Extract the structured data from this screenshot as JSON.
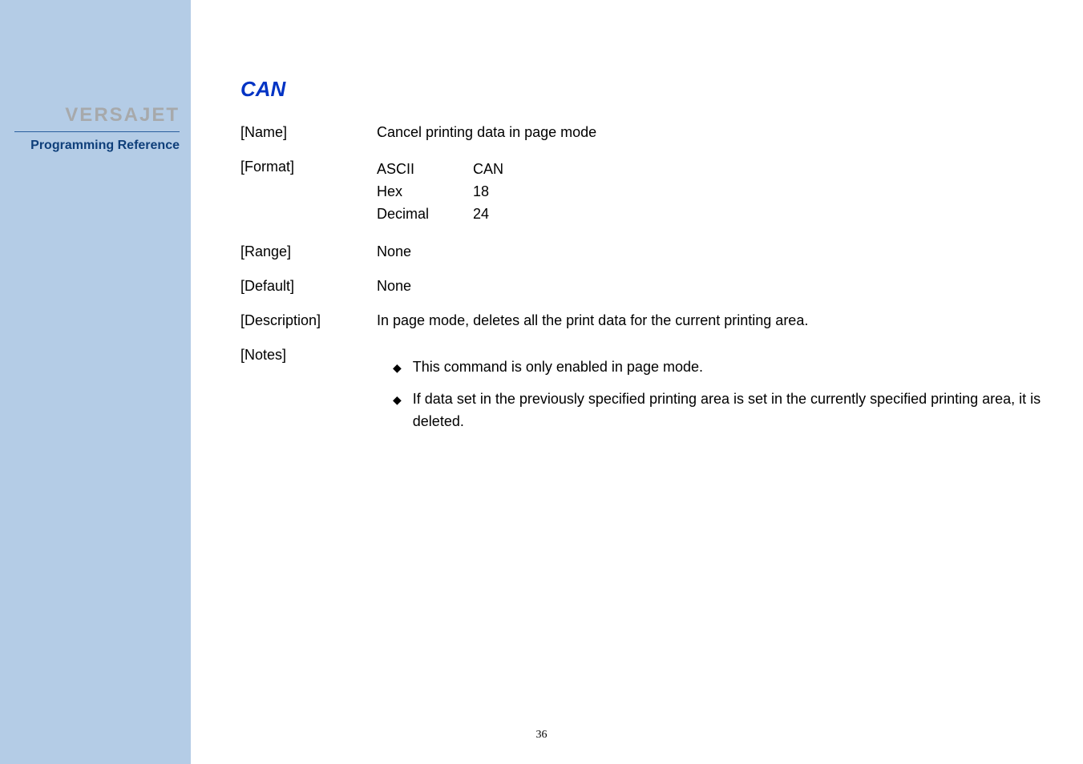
{
  "sidebar": {
    "product": "VERSAJET",
    "subtitle": "Programming Reference"
  },
  "command": {
    "title": "CAN",
    "name_label": "[Name]",
    "name_value": "Cancel printing data in page mode",
    "format_label": "[Format]",
    "formats": [
      {
        "enc": "ASCII",
        "val": "CAN"
      },
      {
        "enc": "Hex",
        "val": "18"
      },
      {
        "enc": "Decimal",
        "val": "24"
      }
    ],
    "range_label": "[Range]",
    "range_value": "None",
    "default_label": "[Default]",
    "default_value": "None",
    "description_label": "[Description]",
    "description_value": "In page mode, deletes all the print data for the current printing area.",
    "notes_label": "[Notes]",
    "notes": [
      "This command is only enabled in page mode.",
      "If data set in the previously specified printing area is set in the currently specified printing area, it is deleted."
    ]
  },
  "page_number": "36"
}
